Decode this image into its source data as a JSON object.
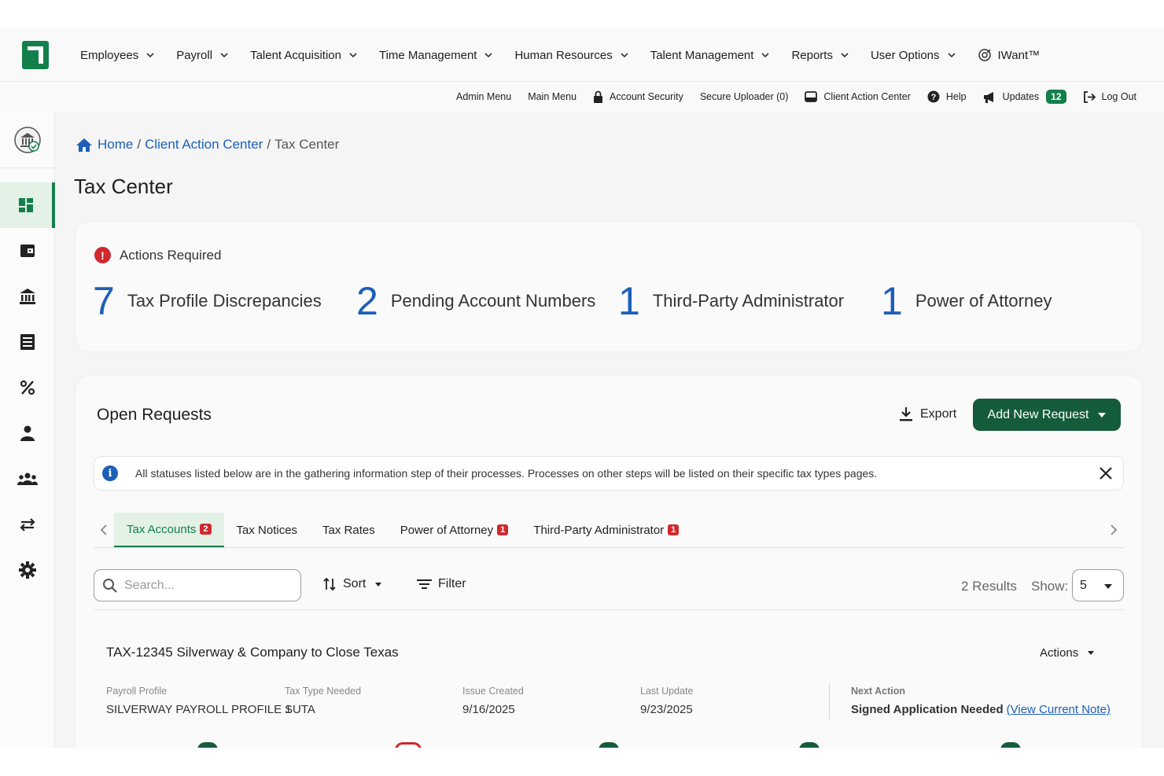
{
  "nav": {
    "menus": [
      "Employees",
      "Payroll",
      "Talent Acquisition",
      "Time Management",
      "Human Resources",
      "Talent Management",
      "Reports",
      "User Options"
    ],
    "iwant_label": "IWant™"
  },
  "subbar": {
    "admin_menu": "Admin Menu",
    "main_menu": "Main Menu",
    "account_security": "Account Security",
    "secure_uploader": "Secure Uploader (0)",
    "client_action_center": "Client Action Center",
    "help": "Help",
    "updates": "Updates",
    "updates_count": "12",
    "log_out": "Log Out"
  },
  "breadcrumb": {
    "home": "Home",
    "client_action_center": "Client Action Center",
    "current": "Tax Center",
    "sep": "/"
  },
  "page_title": "Tax Center",
  "actions_required": {
    "heading": "Actions Required",
    "stats": [
      {
        "count": "7",
        "label": "Tax Profile Discrepancies"
      },
      {
        "count": "2",
        "label": "Pending Account Numbers"
      },
      {
        "count": "1",
        "label": "Third-Party Administrator"
      },
      {
        "count": "1",
        "label": "Power of Attorney"
      }
    ]
  },
  "open_requests": {
    "title": "Open Requests",
    "export_label": "Export",
    "add_button": "Add New Request",
    "info_text": "All statuses listed below are in the gathering information step of their processes. Processes on other steps will be listed on their specific tax types pages.",
    "tabs": [
      {
        "label": "Tax Accounts",
        "badge": "2"
      },
      {
        "label": "Tax Notices",
        "badge": ""
      },
      {
        "label": "Tax Rates",
        "badge": ""
      },
      {
        "label": "Power of Attorney",
        "badge": "1"
      },
      {
        "label": "Third-Party Administrator",
        "badge": "1"
      }
    ],
    "search_placeholder": "Search...",
    "sort_label": "Sort",
    "filter_label": "Filter",
    "results": "2 Results",
    "show_label": "Show:",
    "show_value": "5",
    "request": {
      "name": "TAX-12345 Silverway & Company to Close Texas",
      "actions_label": "Actions",
      "payroll_profile_label": "Payroll Profile",
      "payroll_profile": "SILVERWAY PAYROLL PROFILE 1",
      "tax_type_label": "Tax Type Needed",
      "tax_type": "SUTA",
      "issue_created_label": "Issue Created",
      "issue_created": "9/16/2025",
      "last_update_label": "Last Update",
      "last_update": "9/23/2025",
      "next_action_label": "Next Action",
      "next_action": "Signed Application Needed",
      "view_note": "(View Current Note)"
    }
  },
  "colors": {
    "brand_green": "#137f4a",
    "button_green": "#145c3b",
    "link_blue": "#1c5fb8",
    "alert_red": "#d0282e"
  }
}
